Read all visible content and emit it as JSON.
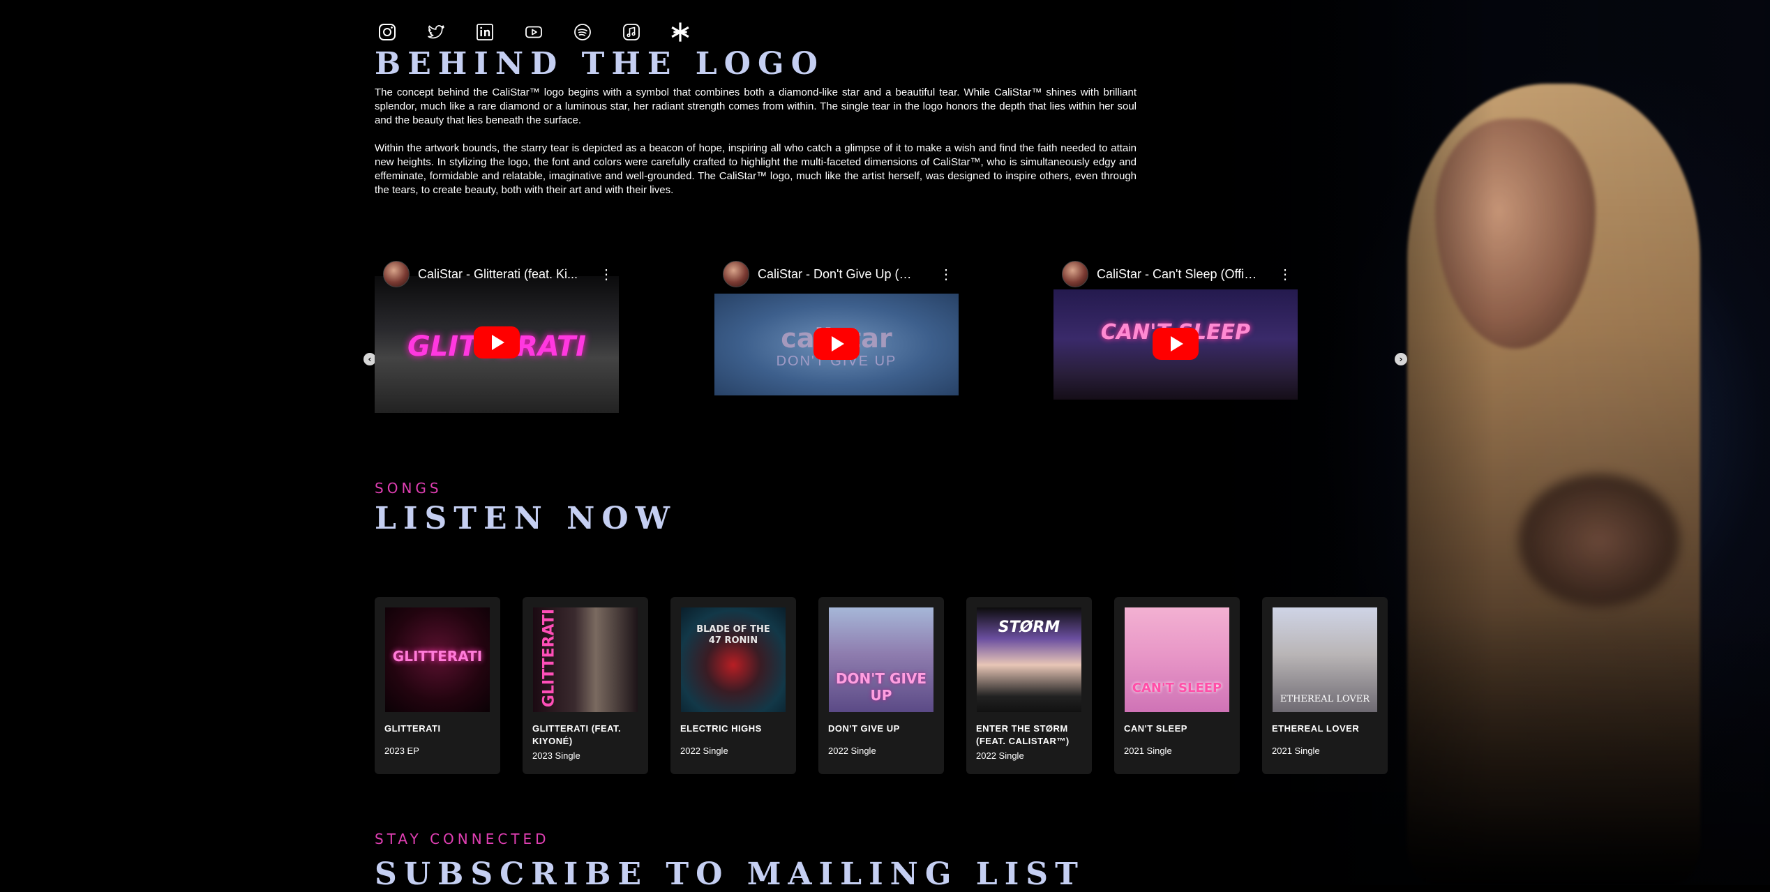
{
  "socials": [
    {
      "name": "instagram-icon"
    },
    {
      "name": "twitter-icon"
    },
    {
      "name": "linkedin-icon"
    },
    {
      "name": "youtube-icon"
    },
    {
      "name": "spotify-icon"
    },
    {
      "name": "apple-music-icon"
    },
    {
      "name": "linktree-icon"
    }
  ],
  "logo_section": {
    "heading": "BEHIND THE LOGO",
    "paragraph_1": "The concept behind the CaliStar™ logo begins with a symbol that combines both a diamond-like star and a beautiful tear. While CaliStar™ shines with brilliant splendor, much like a rare diamond or a luminous star, her radiant strength comes from within. The single tear in the logo honors the depth that lies within her soul and the beauty that lies beneath the surface.",
    "paragraph_2": "Within the artwork bounds, the starry tear is depicted as a beacon of hope, inspiring all who catch a glimpse of it to make a wish and find the faith needed to attain new heights. In stylizing the logo, the font and colors were carefully crafted to highlight the multi-faceted dimensions of CaliStar™, who is simultaneously edgy and effeminate, formidable and relatable, imaginative and well-grounded. The CaliStar™ logo, much like the artist herself, was designed to inspire others, even through the tears, to create beauty, both with their art and with their lives."
  },
  "videos": [
    {
      "title": "CaliStar - Glitterati (feat. Ki...",
      "thumb_text": "GLITTERATI"
    },
    {
      "title": "CaliStar - Don't Give Up (O...",
      "thumb_text": "calistar",
      "thumb_sub": "DON'T GIVE UP"
    },
    {
      "title": "CaliStar - Can't Sleep (Offic...",
      "thumb_text": "CAN'T SLEEP"
    }
  ],
  "songs": {
    "eyebrow": "SONGS",
    "heading": "LISTEN NOW",
    "items": [
      {
        "title": "GLITTERATI",
        "subtitle": "2023 EP",
        "cover_text": "GLITTERATI"
      },
      {
        "title": "GLITTERATI (FEAT. KIYONÉ)",
        "subtitle": "2023 Single",
        "cover_text": "GLITTERATI"
      },
      {
        "title": "ELECTRIC HIGHS",
        "subtitle": "2022 Single",
        "cover_text": "BLADE OF THE 47 RONIN"
      },
      {
        "title": "DON'T GIVE UP",
        "subtitle": "2022 Single",
        "cover_text": "DON'T GIVE UP"
      },
      {
        "title": "ENTER THE STØRM (FEAT. CALISTAR™)",
        "subtitle": "2022 Single",
        "cover_text": "STØRM"
      },
      {
        "title": "CAN'T SLEEP",
        "subtitle": "2021 Single",
        "cover_text": "CAN'T SLEEP"
      },
      {
        "title": "ETHEREAL LOVER",
        "subtitle": "2021 Single",
        "cover_text": "ETHEREAL LOVER"
      }
    ]
  },
  "mailing": {
    "eyebrow": "STAY CONNECTED",
    "heading": "SUBSCRIBE TO MAILING LIST"
  },
  "colors": {
    "background": "#000000",
    "heading": "#c5cff2",
    "accent": "#e03fb3",
    "card": "#1a1a1a",
    "play_button": "#ff0000"
  }
}
